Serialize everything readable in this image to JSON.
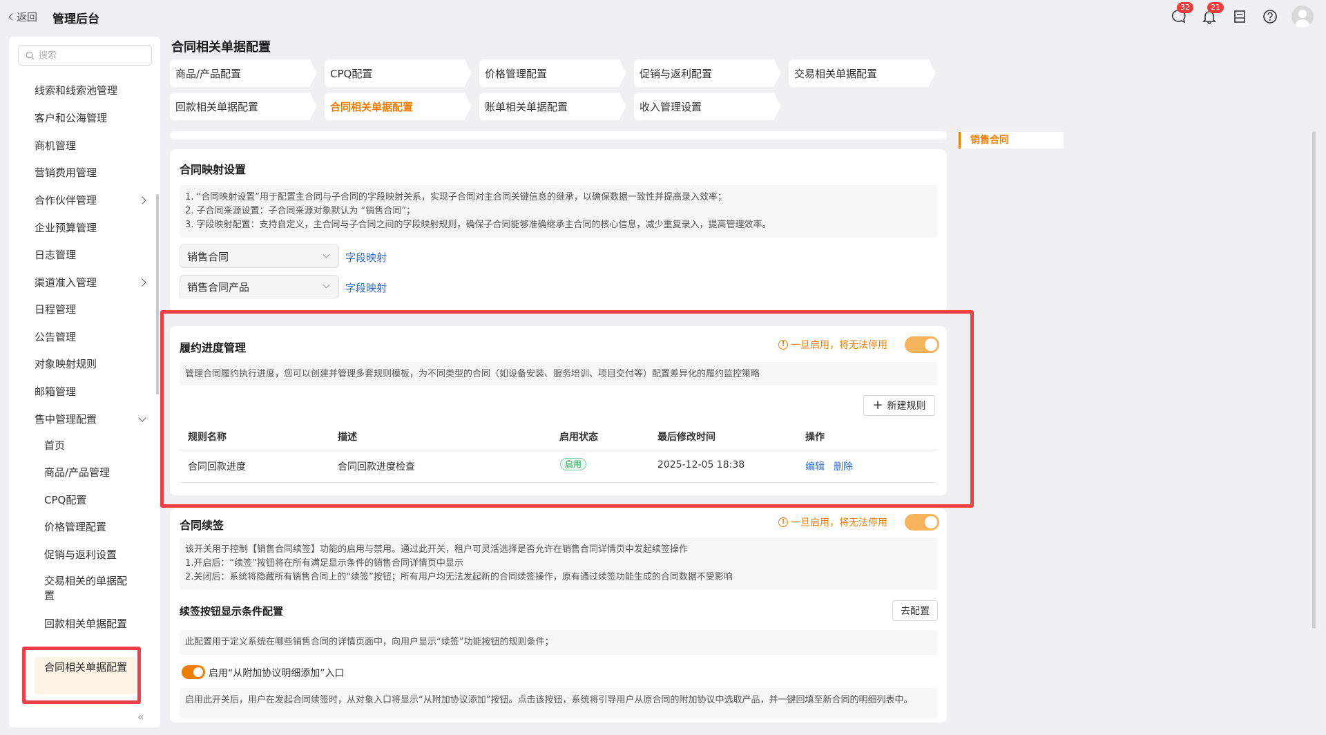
{
  "topbar": {
    "back_label": "返回",
    "title": "管理后台",
    "messages_badge": "32",
    "notifications_badge": "21"
  },
  "sidebar": {
    "search_placeholder": "搜索",
    "items": [
      {
        "label": "线索和线索池管理"
      },
      {
        "label": "客户和公海管理"
      },
      {
        "label": "商机管理"
      },
      {
        "label": "营销费用管理"
      },
      {
        "label": "合作伙伴管理"
      },
      {
        "label": "企业预算管理"
      },
      {
        "label": "日志管理"
      },
      {
        "label": "渠道准入管理"
      },
      {
        "label": "日程管理"
      },
      {
        "label": "公告管理"
      },
      {
        "label": "对象映射规则"
      },
      {
        "label": "邮箱管理"
      },
      {
        "label": "售中管理配置"
      }
    ],
    "sub_items": [
      {
        "label": "首页"
      },
      {
        "label": "商品/产品管理"
      },
      {
        "label": "CPQ配置"
      },
      {
        "label": "价格管理配置"
      },
      {
        "label": "促销与返利设置"
      },
      {
        "label": "交易相关的单据配置"
      },
      {
        "label": "回款相关单据配置"
      },
      {
        "label": "合同相关单据配置"
      }
    ]
  },
  "page": {
    "title": "合同相关单据配置",
    "tabs": [
      {
        "label": "商品/产品配置"
      },
      {
        "label": "CPQ配置"
      },
      {
        "label": "价格管理配置"
      },
      {
        "label": "促销与返利配置"
      },
      {
        "label": "交易相关单据配置"
      },
      {
        "label": "回款相关单据配置"
      },
      {
        "label": "合同相关单据配置"
      },
      {
        "label": "账单相关单据配置"
      },
      {
        "label": "收入管理设置"
      }
    ],
    "anchor": "销售合同"
  },
  "mapping": {
    "title": "合同映射设置",
    "desc": [
      "1. “合同映射设置”用于配置主合同与子合同的字段映射关系，实现子合同对主合同关键信息的继承，以确保数据一致性并提高录入效率；",
      "2. 子合同来源设置：子合同来源对象默认为 “销售合同”；",
      "3. 字段映射配置：支持自定义，主合同与子合同之间的字段映射规则，确保子合同能够准确继承主合同的核心信息，减少重复录入，提高管理效率。"
    ],
    "select1": "销售合同",
    "select2": "销售合同产品",
    "link_label": "字段映射"
  },
  "fulfillment": {
    "title": "履约进度管理",
    "warning": "一旦启用，将无法停用",
    "enabled": true,
    "desc": "管理合同履约执行进度，您可以创建并管理多套规则模板，为不同类型的合同（如设备安装、服务培训、项目交付等）配置差异化的履约监控策略",
    "new_rule": "新建规则",
    "columns": [
      "规则名称",
      "描述",
      "启用状态",
      "最后修改时间",
      "操作"
    ],
    "rows": [
      {
        "name": "合同回款进度",
        "desc": "合同回款进度检查",
        "status": "启用",
        "modified": "2025-12-05 18:38",
        "edit": "编辑",
        "delete": "删除"
      }
    ]
  },
  "renewal": {
    "title": "合同续签",
    "warning": "一旦启用，将无法停用",
    "enabled": true,
    "desc": [
      "该开关用于控制【销售合同续签】功能的启用与禁用。通过此开关，租户可灵活选择是否允许在销售合同详情页中发起续签操作",
      "1.开启后：“续签”按钮将在所有满足显示条件的销售合同详情页中显示",
      "2.关闭后：系统将隐藏所有销售合同上的“续签”按钮；所有用户均无法发起新的合同续签操作，原有通过续签功能生成的合同数据不受影响"
    ],
    "condition_title": "续签按钮显示条件配置",
    "config_button": "去配置",
    "condition_desc": "此配置用于定义系统在哪些销售合同的详情页面中，向用户显示“续签”功能按钮的规则条件；",
    "addon_toggle_label": "启用“从附加协议明细添加”入口",
    "addon_desc": "启用此开关后，用户在发起合同续签时，从对象入口将显示“从附加协议添加”按钮。点击该按钮，系统将引导用户从原合同的附加协议中选取产品，并一键回填至新合同的明细列表中。"
  },
  "colors": {
    "accent": "#f07c00",
    "link": "#2d6be0",
    "highlight": "#ef3e46",
    "success": "#2aa55a"
  }
}
